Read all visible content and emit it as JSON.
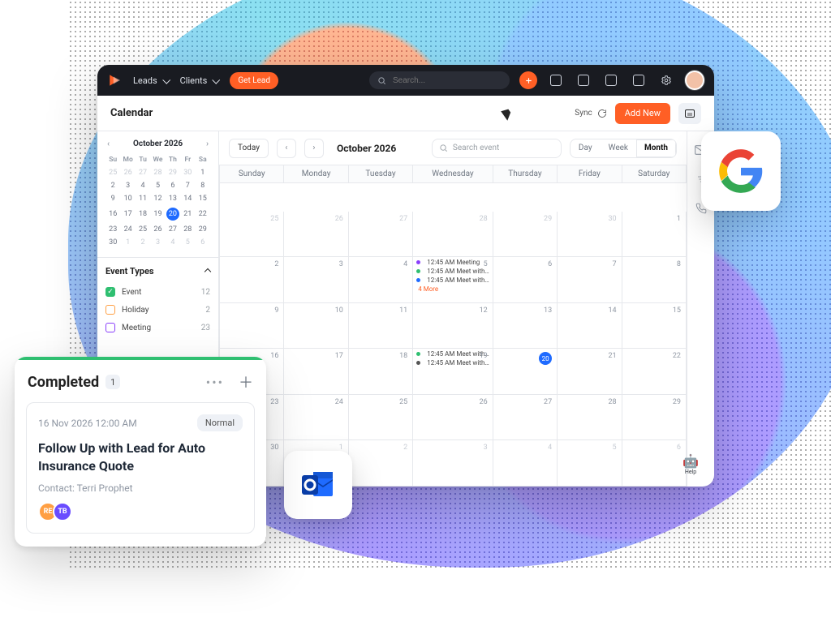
{
  "topbar": {
    "nav": [
      "Leads",
      "Clients"
    ],
    "ctaLabel": "Get Lead",
    "searchPlaceholder": "Search..."
  },
  "page": {
    "title": "Calendar",
    "syncLabel": "Sync",
    "addNewLabel": "Add New"
  },
  "toolbar": {
    "today": "Today",
    "periodLabel": "October 2026",
    "searchPlaceholder": "Search event",
    "views": [
      "Day",
      "Week",
      "Month"
    ]
  },
  "miniCal": {
    "label": "October 2026",
    "dow": [
      "Su",
      "Mo",
      "Tu",
      "We",
      "Th",
      "Fr",
      "Sa"
    ],
    "weeks": [
      [
        {
          "d": 25,
          "out": true
        },
        {
          "d": 26,
          "out": true
        },
        {
          "d": 27,
          "out": true
        },
        {
          "d": 28,
          "out": true
        },
        {
          "d": 29,
          "out": true
        },
        {
          "d": 30,
          "out": true
        },
        {
          "d": 1
        }
      ],
      [
        {
          "d": 2
        },
        {
          "d": 3
        },
        {
          "d": 4
        },
        {
          "d": 5
        },
        {
          "d": 6
        },
        {
          "d": 7
        },
        {
          "d": 8
        }
      ],
      [
        {
          "d": 9
        },
        {
          "d": 10
        },
        {
          "d": 11
        },
        {
          "d": 12
        },
        {
          "d": 13
        },
        {
          "d": 14
        },
        {
          "d": 15
        }
      ],
      [
        {
          "d": 16
        },
        {
          "d": 17
        },
        {
          "d": 18
        },
        {
          "d": 19
        },
        {
          "d": 20,
          "today": true
        },
        {
          "d": 21
        },
        {
          "d": 22
        }
      ],
      [
        {
          "d": 23
        },
        {
          "d": 24
        },
        {
          "d": 25
        },
        {
          "d": 26
        },
        {
          "d": 27
        },
        {
          "d": 28
        },
        {
          "d": 29
        }
      ],
      [
        {
          "d": 30
        },
        {
          "d": 1,
          "out": true
        },
        {
          "d": 2,
          "out": true
        },
        {
          "d": 3,
          "out": true
        },
        {
          "d": 4,
          "out": true
        },
        {
          "d": 5,
          "out": true
        },
        {
          "d": 6,
          "out": true
        }
      ]
    ]
  },
  "eventTypes": {
    "title": "Event Types",
    "items": [
      {
        "label": "Event",
        "count": 12,
        "color": "#2fbf71",
        "filled": true
      },
      {
        "label": "Holiday",
        "count": 2,
        "color": "#ff9f43",
        "filled": false
      },
      {
        "label": "Meeting",
        "count": 23,
        "color": "#8a3ffc",
        "filled": false
      }
    ]
  },
  "monthGrid": {
    "dow": [
      "Sunday",
      "Monday",
      "Tuesday",
      "Wednesday",
      "Thursday",
      "Friday",
      "Saturday"
    ],
    "today": 20,
    "weeks": [
      [
        25,
        26,
        27,
        28,
        29,
        30,
        1
      ],
      [
        2,
        3,
        4,
        5,
        6,
        7,
        8
      ],
      [
        9,
        10,
        11,
        12,
        13,
        14,
        15
      ],
      [
        16,
        17,
        18,
        19,
        20,
        21,
        22
      ],
      [
        23,
        24,
        25,
        26,
        27,
        28,
        29
      ],
      [
        30,
        1,
        2,
        3,
        4,
        5,
        6
      ]
    ],
    "outMask": [
      [
        true,
        true,
        true,
        true,
        true,
        true,
        false
      ],
      [
        false,
        false,
        false,
        false,
        false,
        false,
        false
      ],
      [
        false,
        false,
        false,
        false,
        false,
        false,
        false
      ],
      [
        false,
        false,
        false,
        false,
        false,
        false,
        false
      ],
      [
        false,
        false,
        false,
        false,
        false,
        false,
        false
      ],
      [
        false,
        true,
        true,
        true,
        true,
        true,
        true
      ]
    ],
    "events": {
      "5": [
        {
          "time": "12:45 AM",
          "title": "Meeting",
          "color": "#8a3ffc"
        },
        {
          "time": "12:45 AM",
          "title": "Meet with…",
          "color": "#2fbf71"
        },
        {
          "time": "12:45 AM",
          "title": "Meet with…",
          "color": "#1f6bff"
        }
      ],
      "5_more": "4 More",
      "19": [
        {
          "time": "12:45 AM",
          "title": "Meet with…",
          "color": "#2fbf71"
        },
        {
          "time": "12:45 AM",
          "title": "Meet with…",
          "color": "#555"
        }
      ]
    }
  },
  "help": {
    "label": "Help"
  },
  "taskCard": {
    "title": "Completed",
    "count": "1",
    "item": {
      "datetime": "16 Nov 2026 12:00 AM",
      "priority": "Normal",
      "title": "Follow Up with Lead for Auto Insurance Quote",
      "contact": "Contact: Terri Prophet",
      "assignees": [
        "RE",
        "TB"
      ]
    }
  },
  "colors": {
    "accent": "#ff5f25",
    "blue": "#1f6bff",
    "green": "#2fbf71",
    "purple": "#8a3ffc"
  }
}
